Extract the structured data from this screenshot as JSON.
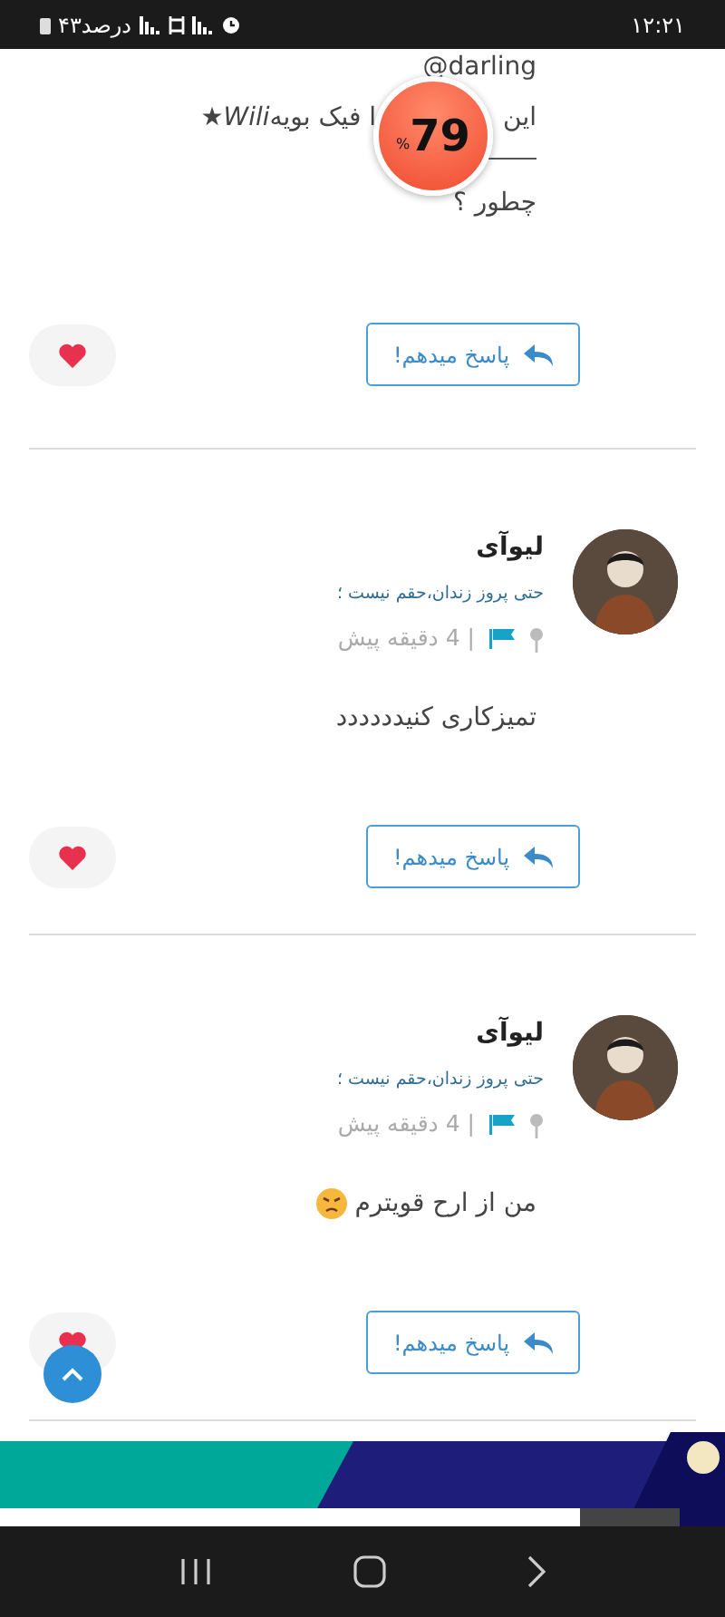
{
  "status_bar": {
    "time": "۱۲:۲۱",
    "battery": "۴۳درصد"
  },
  "battery_widget": {
    "value": "79",
    "unit": "%"
  },
  "posts": [
    {
      "kind": "continued",
      "lines": [
        {
          "kind": "text",
          "text": "darling@"
        },
        {
          "kind": "split",
          "parts": [
            "این",
            [
              {
                "text": "ا فیک بویه",
                "italic": false
              },
              {
                "text": "Wili",
                "italic": true
              },
              {
                "text": "★",
                "italic": false
              }
            ]
          ]
        },
        {
          "kind": "rule"
        },
        {
          "kind": "text",
          "text": "چطور ؟"
        }
      ],
      "reply_label": "پاسخ میدهم!"
    },
    {
      "kind": "full",
      "author": "لیوآی",
      "tagline": "حتی پروز زندان،حقم نیست ؛",
      "time": "| 4 دقیقه پیش",
      "body": "تمیزکاری کنیدددددد",
      "has_emoji": false,
      "reply_label": "پاسخ میدهم!"
    },
    {
      "kind": "full",
      "author": "لیوآی",
      "tagline": "حتی پروز زندان،حقم نیست ؛",
      "time": "| 4 دقیقه پیش",
      "body": "من از ارح قویترم",
      "has_emoji": true,
      "reply_label": "پاسخ میدهم!"
    }
  ]
}
